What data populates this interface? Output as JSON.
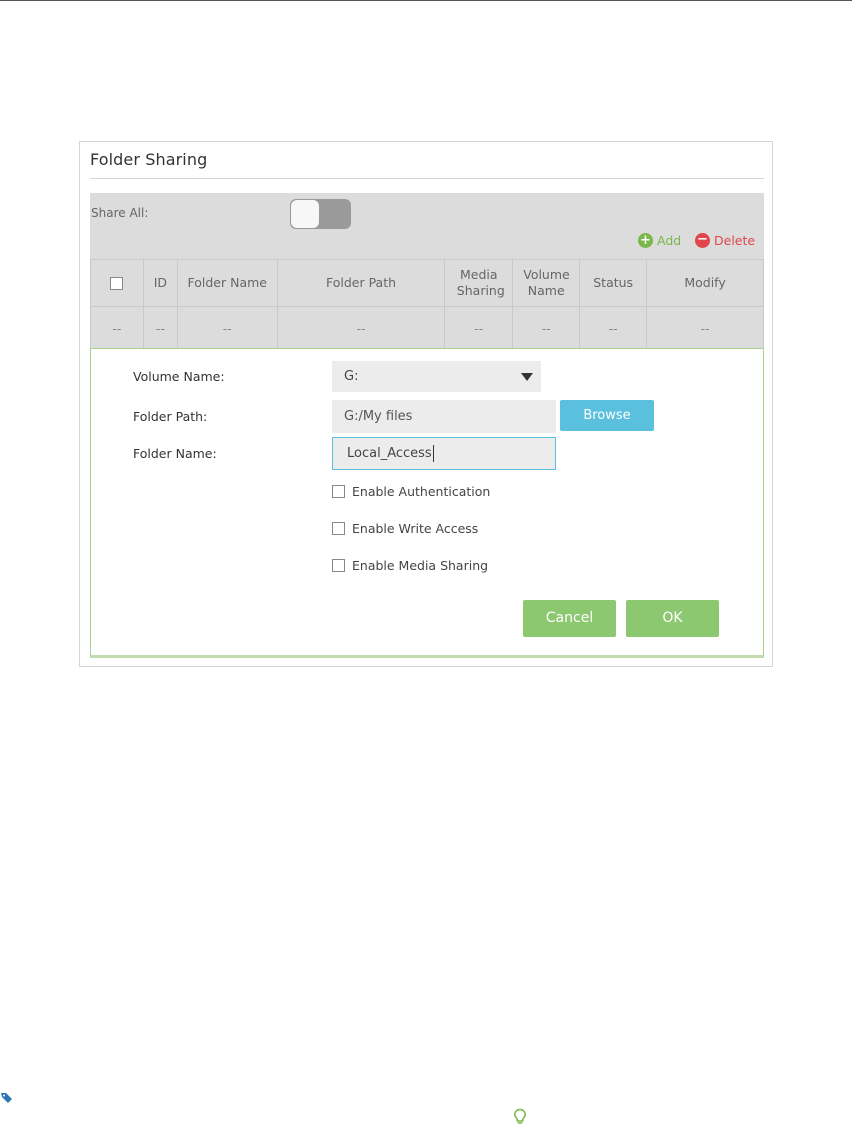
{
  "panel": {
    "title": "Folder Sharing",
    "share_all_label": "Share All:",
    "share_all_on": false,
    "add_label": "Add",
    "delete_label": "Delete"
  },
  "table": {
    "headers": [
      "",
      "ID",
      "Folder Name",
      "Folder Path",
      "Media Sharing",
      "Volume Name",
      "Status",
      "Modify"
    ],
    "rows": [
      [
        "--",
        "--",
        "--",
        "--",
        "--",
        "--",
        "--",
        "--"
      ]
    ]
  },
  "form": {
    "volume_label": "Volume Name:",
    "volume_value": "G:",
    "path_label": "Folder Path:",
    "path_value": "G:/My files",
    "browse_label": "Browse",
    "name_label": "Folder Name:",
    "name_value": "Local_Access",
    "checkboxes": [
      {
        "label": "Enable Authentication",
        "checked": false
      },
      {
        "label": "Enable Write Access",
        "checked": false
      },
      {
        "label": "Enable Media Sharing",
        "checked": false
      }
    ],
    "cancel_label": "Cancel",
    "ok_label": "OK"
  },
  "colors": {
    "accent_green": "#8cc870",
    "add_green": "#7ab648",
    "delete_red": "#e0474c",
    "browse_blue": "#5bc0de"
  },
  "icons": [
    "add-circle-icon",
    "delete-circle-icon",
    "dropdown-arrow-icon",
    "tag-icon",
    "lightbulb-icon"
  ]
}
